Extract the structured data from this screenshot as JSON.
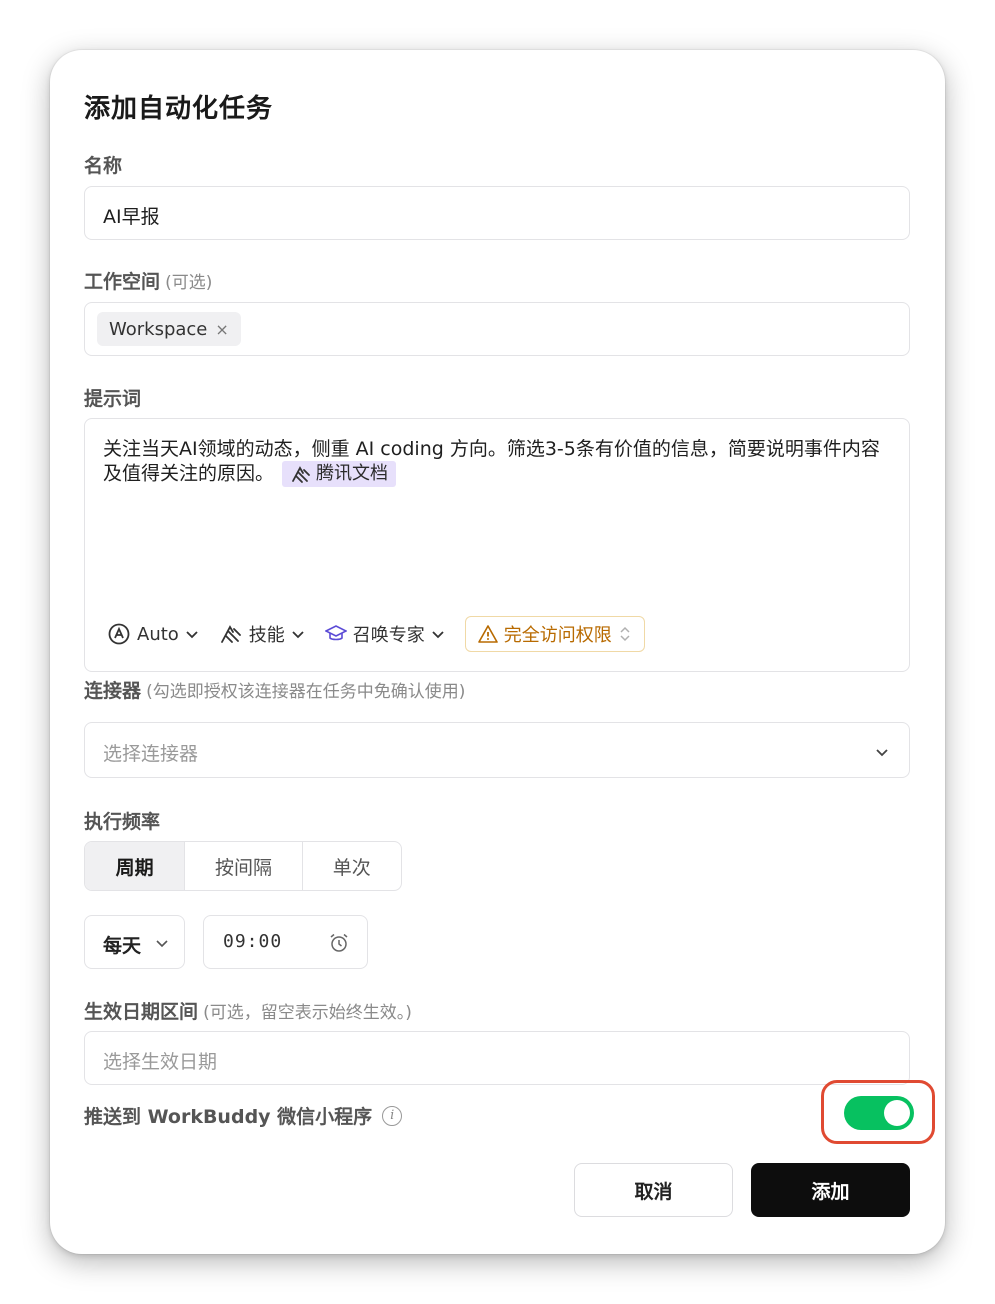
{
  "dialog": {
    "title": "添加自动化任务"
  },
  "name_field": {
    "label": "名称",
    "value": "AI早报"
  },
  "workspace_field": {
    "label": "工作空间",
    "hint": "(可选)",
    "tag": "Workspace",
    "tag_remove": "×"
  },
  "prompt_field": {
    "label": "提示词",
    "text": "关注当天AI领域的动态，侧重 AI coding 方向。筛选3-5条有价值的信息，简要说明事件内容及值得关注的原因。",
    "chip": "腾讯文档",
    "toolbar": {
      "model": "Auto",
      "skills": "技能",
      "experts": "召唤专家",
      "access": "完全访问权限"
    }
  },
  "connector_field": {
    "label": "连接器",
    "hint": "(勾选即授权该连接器在任务中免确认使用)",
    "placeholder": "选择连接器"
  },
  "frequency": {
    "label": "执行频率",
    "tabs": [
      "周期",
      "按间隔",
      "单次"
    ],
    "active_tab": "周期",
    "repeat": "每天",
    "time": "09:00"
  },
  "date_range": {
    "label": "生效日期区间",
    "hint": "(可选，留空表示始终生效。)",
    "placeholder": "选择生效日期"
  },
  "push": {
    "label": "推送到 WorkBuddy 微信小程序",
    "info_icon": "i",
    "enabled": true
  },
  "actions": {
    "cancel": "取消",
    "add": "添加"
  },
  "colors": {
    "toggle_on": "#07c160",
    "highlight_ring": "#e04a32",
    "chip_bg": "#e7e0fb",
    "warning": "#b86a00",
    "primary_button": "#0d0d0d"
  },
  "icons": [
    "auto-model-icon",
    "chevron-down-icon",
    "skills-icon",
    "expert-cap-icon",
    "warning-icon",
    "updown-chevron-icon",
    "alarm-clock-icon",
    "info-icon",
    "close-icon"
  ]
}
